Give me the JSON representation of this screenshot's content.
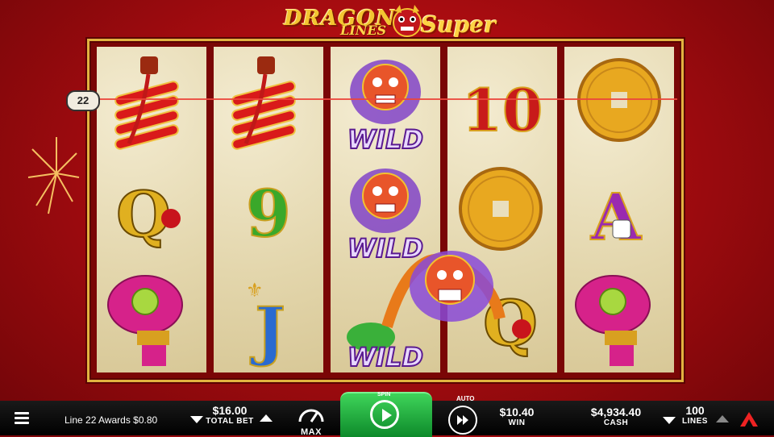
{
  "game": {
    "logo": {
      "word1": "DRAGON",
      "word2": "LINES",
      "word3": "Super"
    },
    "payline_number": "22",
    "reels": [
      [
        "firecrackers",
        "Q",
        "lantern"
      ],
      [
        "firecrackers",
        "9",
        "J"
      ],
      [
        "WILD",
        "WILD",
        "WILD"
      ],
      [
        "10",
        "coin",
        "Q"
      ],
      [
        "coin",
        "A",
        "lantern"
      ]
    ]
  },
  "bottom_bar": {
    "status": "Line 22 Awards $0.80",
    "total_bet_value": "$16.00",
    "total_bet_label": "TOTAL BET",
    "max_label": "MAX",
    "spin_label": "SPIN",
    "auto_label": "AUTO",
    "win_value": "$10.40",
    "win_label": "WIN",
    "cash_value": "$4,934.40",
    "cash_label": "CASH",
    "lines_value": "100",
    "lines_label": "LINES"
  },
  "colors": {
    "background": "#c0101a",
    "frame_gold": "#e2b340",
    "spin_green": "#1faa3c",
    "reel_bg": "#e9dfbd"
  }
}
